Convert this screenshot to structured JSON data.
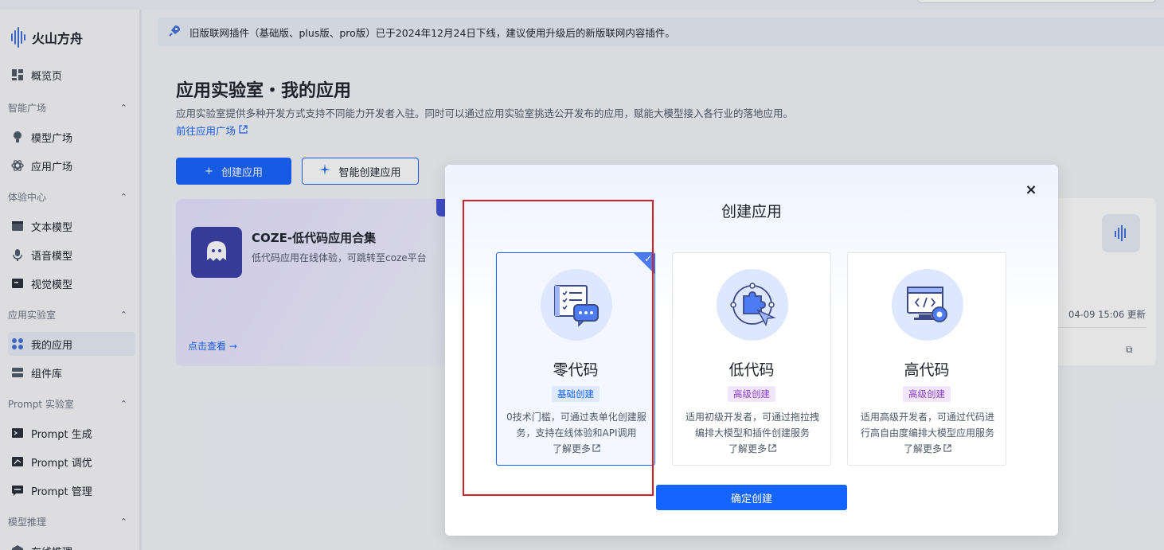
{
  "brand": {
    "name": "火山方舟"
  },
  "sidebar": {
    "overview": "概览页",
    "groups": [
      {
        "label": "智能广场",
        "items": [
          "模型广场",
          "应用广场"
        ]
      },
      {
        "label": "体验中心",
        "items": [
          "文本模型",
          "语音模型",
          "视觉模型"
        ]
      },
      {
        "label": "应用实验室",
        "items": [
          "我的应用",
          "组件库"
        ]
      },
      {
        "label": "Prompt 实验室",
        "items": [
          "Prompt 生成",
          "Prompt 调优",
          "Prompt 管理"
        ]
      },
      {
        "label": "模型推理",
        "items": [
          "在线推理"
        ]
      }
    ],
    "active_item": "我的应用"
  },
  "banner": {
    "text": "旧版联网插件（基础版、plus版、pro版）已于2024年12月24日下线，建议使用升级后的新版联网内容插件。"
  },
  "page": {
    "title": "应用实验室・我的应用",
    "description": "应用实验室提供多种开发方式支持不同能力开发者入驻。同时可以通过应用实验室挑选公开发布的应用，赋能大模型接入各行业的落地应用。",
    "link": "前往应用广场",
    "create_button": "创建应用",
    "smart_create_button": "智能创建应用"
  },
  "coze_card": {
    "title": "COZE-低代码应用合集",
    "description": "低代码应用在线体验，可跳转至coze平台",
    "link": "点击查看 →"
  },
  "right_card": {
    "updated": "04-09 15:06 更新"
  },
  "modal": {
    "title": "创建应用",
    "close": "×",
    "options": [
      {
        "title": "零代码",
        "tag": "基础创建",
        "desc": "0技术门槛，可通过表单化创建服务，支持在线体验和API调用",
        "more": "了解更多",
        "selected": true
      },
      {
        "title": "低代码",
        "tag": "高级创建",
        "desc": "适用初级开发者，可通过拖拉拽编排大模型和插件创建服务",
        "more": "了解更多",
        "selected": false
      },
      {
        "title": "高代码",
        "tag": "高级创建",
        "desc": "适用高级开发者，可通过代码进行高自由度编排大模型应用服务",
        "more": "了解更多",
        "selected": false
      }
    ],
    "confirm": "确定创建"
  },
  "colors": {
    "primary": "#1664ff",
    "highlight": "#d4202c"
  },
  "icons": [
    "rocket-icon",
    "grid-icon",
    "bulb-icon",
    "atom-icon",
    "monitor-icon",
    "mic-icon",
    "screen-icon",
    "apps-icon",
    "stack-icon",
    "terminal-icon",
    "external-link-icon",
    "plus-icon",
    "sparkle-icon",
    "copy-icon",
    "checkmark-icon",
    "close-icon"
  ]
}
